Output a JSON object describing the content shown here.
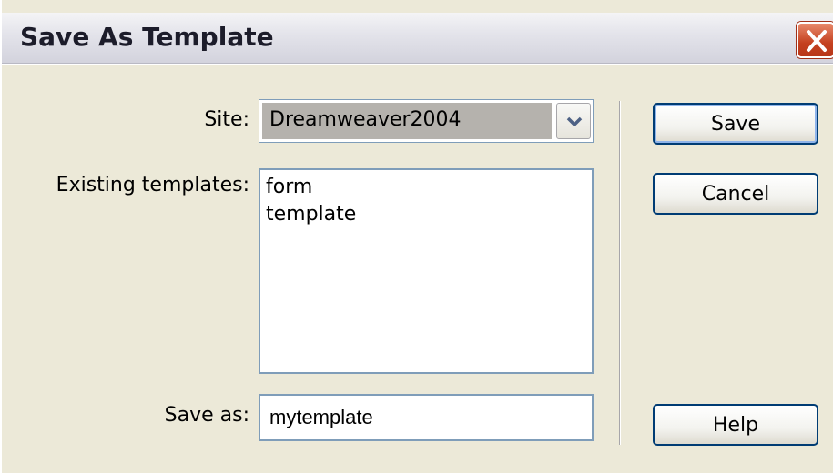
{
  "window": {
    "title": "Save As Template",
    "close_icon": "close-icon"
  },
  "form": {
    "site_label": "Site:",
    "site_value": "Dreamweaver2004",
    "existing_label": "Existing templates:",
    "existing_templates": [
      "form",
      "template"
    ],
    "save_as_label": "Save as:",
    "save_as_value": "mytemplate"
  },
  "buttons": {
    "save": "Save",
    "cancel": "Cancel",
    "help": "Help"
  },
  "colors": {
    "close_button": "#c4401f",
    "button_border": "#003c74",
    "dialog_bg": "#ece9d8"
  }
}
